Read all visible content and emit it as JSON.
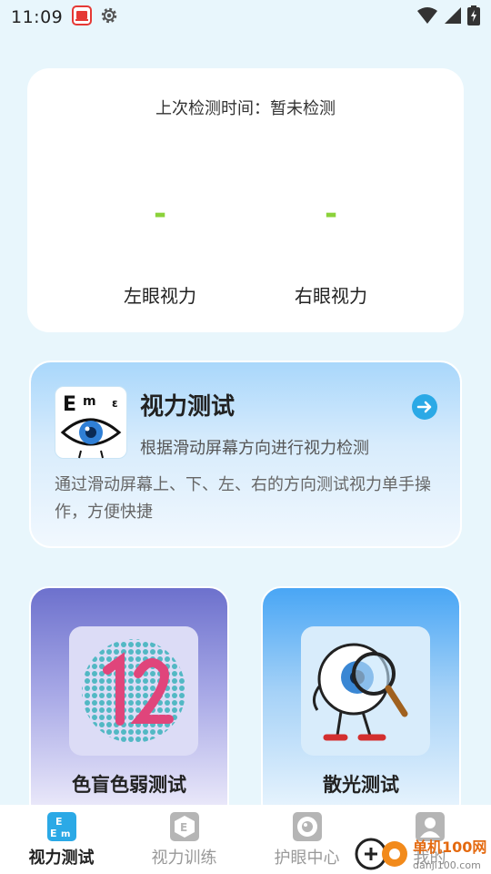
{
  "status_bar": {
    "time": "11:09",
    "icons": [
      "notification-app-icon",
      "settings-gear-icon",
      "wifi-icon",
      "signal-icon",
      "battery-charging-icon"
    ]
  },
  "summary": {
    "last_check_label": "上次检测时间：暂未检测",
    "left_eye": {
      "value": "-",
      "label": "左眼视力"
    },
    "right_eye": {
      "value": "-",
      "label": "右眼视力"
    },
    "accent_color": "#8bd23a"
  },
  "vision_test": {
    "title": "视力测试",
    "subtitle": "根据滑动屏幕方向进行视力检测",
    "description": "通过滑动屏幕上、下、左、右的方向测试视力单手操作，方便快捷",
    "icon": "eye-chart-icon",
    "action_icon": "arrow-right-circle-icon"
  },
  "features": [
    {
      "label": "色盲色弱测试",
      "icon": "color-plate-icon"
    },
    {
      "label": "散光测试",
      "icon": "eyeball-magnifier-icon"
    }
  ],
  "bottom_nav": [
    {
      "label": "视力测试",
      "icon": "vision-test-tab-icon",
      "active": true
    },
    {
      "label": "视力训练",
      "icon": "vision-training-tab-icon",
      "active": false
    },
    {
      "label": "护眼中心",
      "icon": "eye-care-tab-icon",
      "active": false
    },
    {
      "label": "我的",
      "icon": "profile-tab-icon",
      "active": false
    }
  ],
  "watermark": {
    "text": "danji100.com",
    "brand_text": "单机100网"
  },
  "colors": {
    "background": "#e8f6fc",
    "primary": "#2ba9e6",
    "active_nav": "#222222",
    "inactive_nav": "#999999"
  }
}
